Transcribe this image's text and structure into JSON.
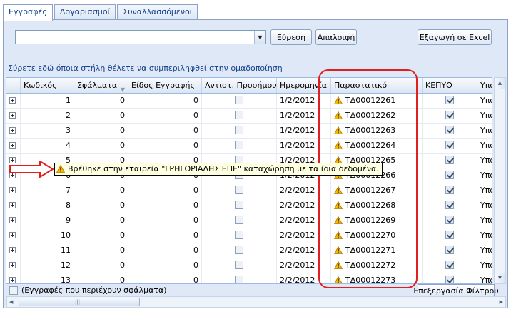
{
  "tabs": [
    "Εγγραφές",
    "Λογαριασμοί",
    "Συναλλασσόμενοι"
  ],
  "toolbar": {
    "search_value": "",
    "find_label": "Εύρεση",
    "clear_label": "Απαλοιφή",
    "export_label": "Εξαγωγή σε Excel"
  },
  "group_hint": "Σύρετε εδώ όποια στήλη θέλετε να συμπεριληφθεί στην ομαδοποίηση",
  "columns": [
    "Κωδικός",
    "Σφάλματα",
    "Είδος Εγγραφής",
    "Αντιστ. Προσήμου",
    "Ημερομηνία",
    "Παραστατικό",
    "ΚΕΠΥΟ",
    "Υποχρ"
  ],
  "rows": [
    {
      "code": "1",
      "errors": "0",
      "type": "0",
      "sign": false,
      "date": "1/2/2012",
      "doc": "ΤΔ00012261",
      "kepyo": true,
      "oblig": "Υποχρ"
    },
    {
      "code": "2",
      "errors": "0",
      "type": "0",
      "sign": false,
      "date": "1/2/2012",
      "doc": "ΤΔ00012262",
      "kepyo": true,
      "oblig": "Υποχρ"
    },
    {
      "code": "3",
      "errors": "0",
      "type": "0",
      "sign": false,
      "date": "1/2/2012",
      "doc": "ΤΔ00012263",
      "kepyo": true,
      "oblig": "Υποχρ"
    },
    {
      "code": "4",
      "errors": "0",
      "type": "0",
      "sign": false,
      "date": "1/2/2012",
      "doc": "ΤΔ00012264",
      "kepyo": true,
      "oblig": "Υποχρ"
    },
    {
      "code": "5",
      "errors": "0",
      "type": "0",
      "sign": false,
      "date": "1/2/2012",
      "doc": "ΤΔ00012265",
      "kepyo": true,
      "oblig": "Υποχρ"
    },
    {
      "code": "6",
      "errors": "0",
      "type": "0",
      "sign": false,
      "date": "1/2/2012",
      "doc": "ΤΔ00012266",
      "kepyo": true,
      "oblig": "Υποχρ"
    },
    {
      "code": "7",
      "errors": "0",
      "type": "0",
      "sign": false,
      "date": "2/2/2012",
      "doc": "ΤΔ00012267",
      "kepyo": true,
      "oblig": "Υποχρ"
    },
    {
      "code": "8",
      "errors": "0",
      "type": "0",
      "sign": false,
      "date": "2/2/2012",
      "doc": "ΤΔ00012268",
      "kepyo": true,
      "oblig": "Υποχρ"
    },
    {
      "code": "9",
      "errors": "0",
      "type": "0",
      "sign": false,
      "date": "2/2/2012",
      "doc": "ΤΔ00012269",
      "kepyo": true,
      "oblig": "Υποχρ"
    },
    {
      "code": "10",
      "errors": "0",
      "type": "0",
      "sign": false,
      "date": "2/2/2012",
      "doc": "ΤΔ00012270",
      "kepyo": true,
      "oblig": "Υποχρ"
    },
    {
      "code": "11",
      "errors": "0",
      "type": "0",
      "sign": false,
      "date": "2/2/2012",
      "doc": "ΤΔ00012271",
      "kepyo": true,
      "oblig": "Υποχρ"
    },
    {
      "code": "12",
      "errors": "0",
      "type": "0",
      "sign": false,
      "date": "2/2/2012",
      "doc": "ΤΔ00012272",
      "kepyo": true,
      "oblig": "Υποχρ"
    },
    {
      "code": "13",
      "errors": "0",
      "type": "0",
      "sign": false,
      "date": "2/2/2012",
      "doc": "ΤΔ00012273",
      "kepyo": true,
      "oblig": "Υποχρ"
    }
  ],
  "tooltip": "Βρέθηκε στην εταιρεία \"ΓΡΗΓΟΡΙΑΔΗΣ ΕΠΕ\" καταχώρηση με τα ίδια δεδομένα.",
  "footer": {
    "errors_filter_label": "(Εγγραφές που περιέχουν σφάλματα)",
    "edit_filter_label": "Επεξεργασία Φίλτρου"
  },
  "icons": {
    "warning": "warning-icon",
    "expand": "expand-plus-icon",
    "filter": "filter-icon",
    "arrow": "red-arrow-annotation"
  },
  "colors": {
    "accent": "#15428b",
    "panel": "#dfe8f6",
    "highlight": "#e02020",
    "tooltip_bg": "#ffffe1"
  }
}
